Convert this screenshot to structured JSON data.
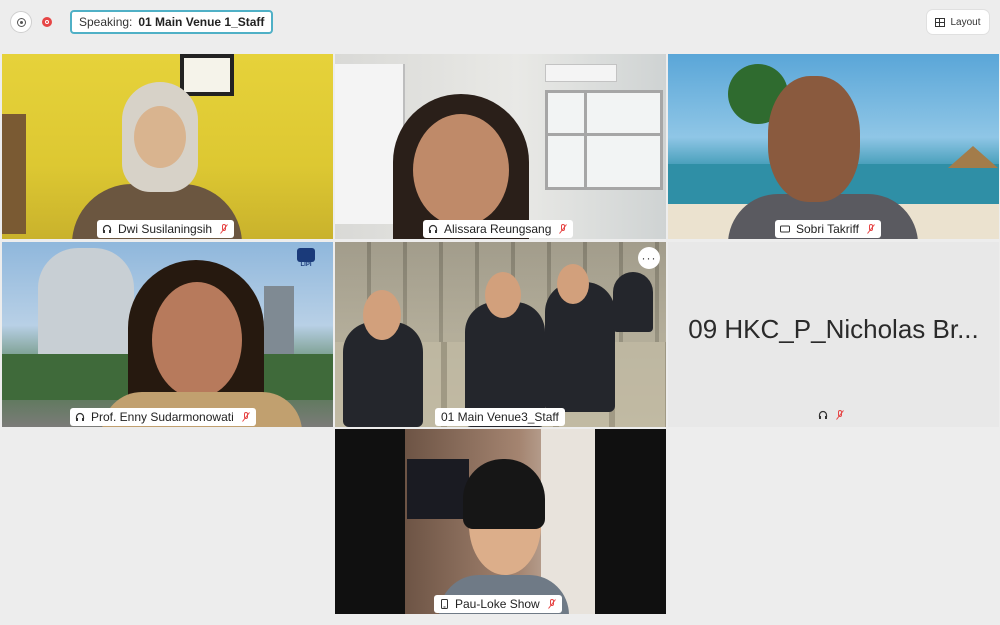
{
  "topbar": {
    "speaking_label": "Speaking:",
    "speaking_name": "01 Main Venue 1_Staff",
    "layout_label": "Layout",
    "icons": [
      "info-icon",
      "record-icon",
      "layout-grid-icon"
    ]
  },
  "participants": [
    {
      "name": "Dwi Susilaningsih",
      "audio_icon": "headset-icon",
      "muted": true
    },
    {
      "name": "Alissara Reungsang",
      "audio_icon": "headset-icon",
      "muted": true
    },
    {
      "name": "Sobri Takriff",
      "audio_icon": "camera-icon",
      "muted": true
    },
    {
      "name": "Prof. Enny Sudarmonowati",
      "audio_icon": "headset-icon",
      "muted": true,
      "logo_text": "LIPI"
    },
    {
      "name": "01 Main Venue3_Staff",
      "audio_icon": "",
      "muted": false,
      "more_label": "···"
    },
    {
      "name": "09 HKC_P_Nicholas Br...",
      "audio_icon": "headset-icon",
      "muted": true,
      "video_off": true
    },
    {
      "name": "Pau-Loke Show",
      "audio_icon": "phone-icon",
      "muted": true
    }
  ],
  "colors": {
    "accent_border": "#4fb0c6",
    "record": "#e64545",
    "mute": "#e64545",
    "background": "#ededed"
  }
}
